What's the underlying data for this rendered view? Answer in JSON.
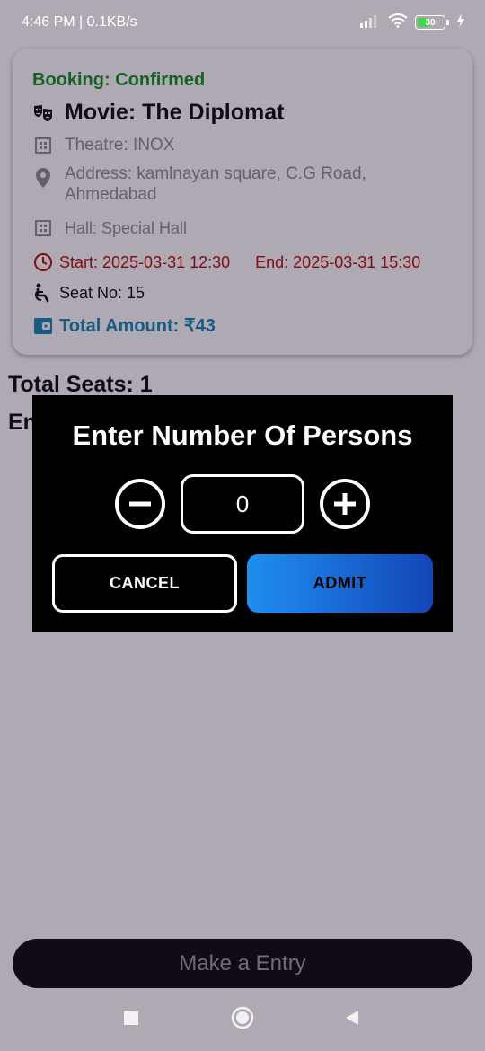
{
  "status_bar": {
    "time_speed": "4:46 PM | 0.1KB/s",
    "battery": "30"
  },
  "booking": {
    "status": "Booking: Confirmed",
    "movie": "Movie: The Diplomat",
    "theatre": "Theatre: INOX",
    "address_line1": "Address: kamlnayan square, C.G Road,",
    "address_line2": "Ahmedabad",
    "hall": "Hall: Special Hall",
    "start": "Start: 2025-03-31 12:30",
    "end": "End: 2025-03-31 15:30",
    "seat": "Seat No: 15",
    "total": "Total Amount: ₹43"
  },
  "summary": {
    "total_seats": "Total Seats: 1",
    "entries_label": "En"
  },
  "dialog": {
    "title": "Enter Number Of Persons",
    "quantity": "0",
    "cancel_label": "CANCEL",
    "admit_label": "ADMIT"
  },
  "footer": {
    "entry_button": "Make a Entry"
  },
  "colors": {
    "confirmed": "#0b8a17",
    "time": "#b40000",
    "amount": "#0f7fb0",
    "admit_start": "#1e8ff0",
    "admit_end": "#1346b8"
  },
  "icons": [
    "wifi-icon",
    "signal-icon",
    "battery-icon",
    "charging-icon",
    "theater-masks-icon",
    "building-icon",
    "location-pin-icon",
    "clock-icon",
    "wheelchair-seat-icon",
    "wallet-icon",
    "minus-circle-icon",
    "plus-circle-icon"
  ]
}
